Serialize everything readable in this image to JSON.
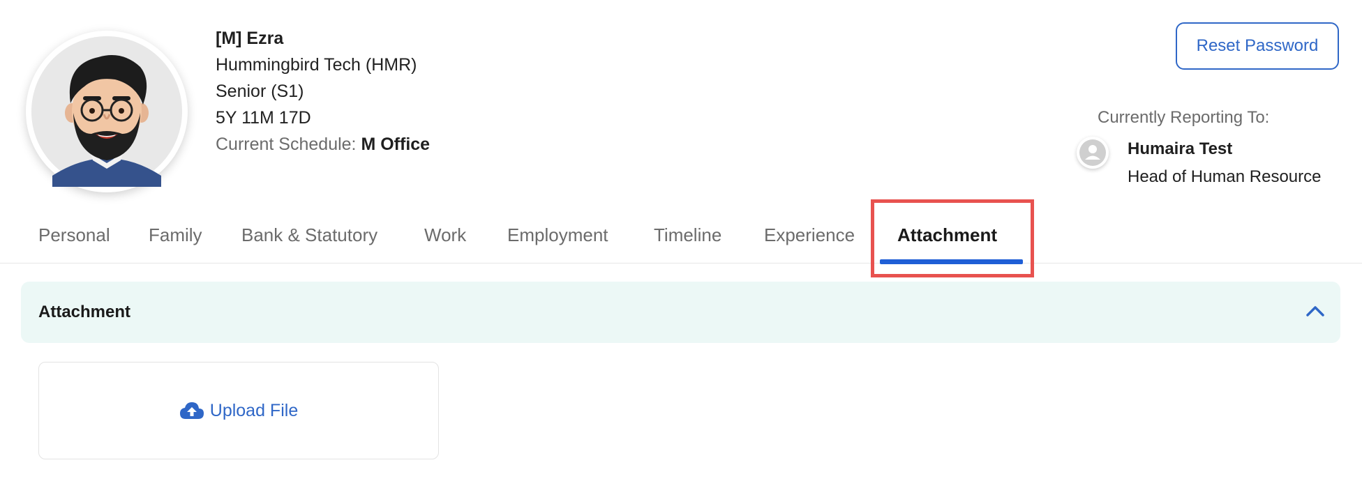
{
  "profile": {
    "name": "[M] Ezra",
    "company": "Hummingbird Tech (HMR)",
    "level": "Senior (S1)",
    "tenure": "5Y 11M 17D",
    "schedule_label": "Current Schedule:",
    "schedule_value": "M Office"
  },
  "header": {
    "reset_password_label": "Reset Password",
    "reporting_label": "Currently Reporting To:",
    "manager_name": "Humaira Test",
    "manager_role": "Head of Human Resource"
  },
  "tabs": [
    {
      "label": "Personal"
    },
    {
      "label": "Family"
    },
    {
      "label": "Bank & Statutory"
    },
    {
      "label": "Work"
    },
    {
      "label": "Employment"
    },
    {
      "label": "Timeline"
    },
    {
      "label": "Experience"
    },
    {
      "label": "Attachment",
      "active": true
    }
  ],
  "section": {
    "title": "Attachment",
    "upload_label": "Upload File"
  },
  "colors": {
    "accent": "#2f67c7",
    "active_tab_underline": "#1f5fd6",
    "highlight": "#e8524f",
    "section_bg": "#ecf8f6"
  },
  "icons": {
    "avatar": "user-avatar",
    "manager_avatar": "person-placeholder-icon",
    "collapse": "chevron-up-icon",
    "upload": "cloud-upload-icon"
  }
}
